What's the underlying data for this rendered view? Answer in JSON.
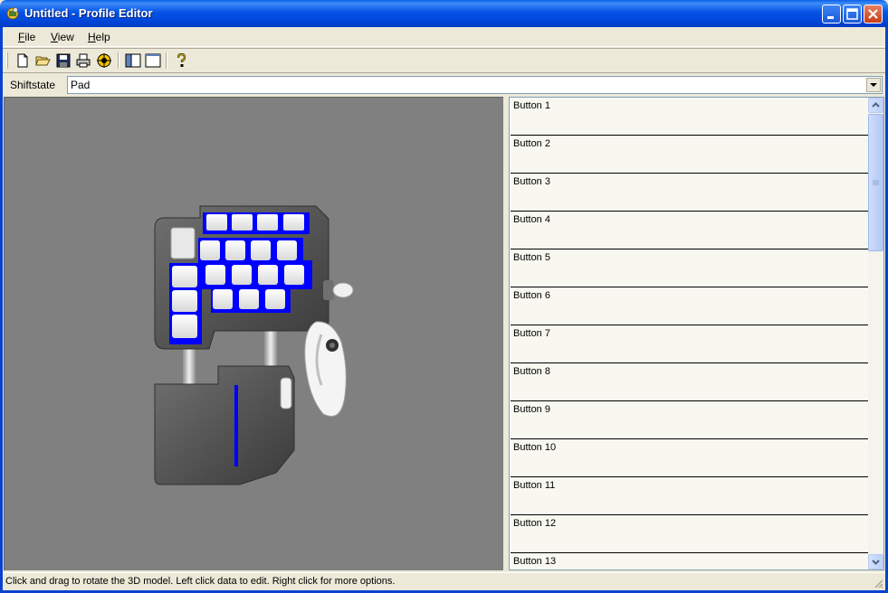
{
  "window": {
    "title": "Untitled - Profile Editor"
  },
  "menu": {
    "items": [
      {
        "label": "File",
        "accel": "F",
        "rest": "ile"
      },
      {
        "label": "View",
        "accel": "V",
        "rest": "iew"
      },
      {
        "label": "Help",
        "accel": "H",
        "rest": "elp"
      }
    ]
  },
  "toolbar": {
    "buttons": [
      "new-icon",
      "open-icon",
      "save-icon",
      "print-icon",
      "target-icon",
      "split-view-icon",
      "single-view-icon",
      "help-icon"
    ]
  },
  "shiftstate": {
    "label": "Shiftstate",
    "value": "Pad"
  },
  "button_list": {
    "items": [
      "Button 1",
      "Button 2",
      "Button 3",
      "Button 4",
      "Button 5",
      "Button 6",
      "Button 7",
      "Button 8",
      "Button 9",
      "Button 10",
      "Button 11",
      "Button 12",
      "Button 13"
    ]
  },
  "status": {
    "text": "Click and drag to rotate the 3D model. Left click data to edit. Right click for more options."
  },
  "colors": {
    "highlight": "#0000FF",
    "viewport_bg": "#808080"
  }
}
